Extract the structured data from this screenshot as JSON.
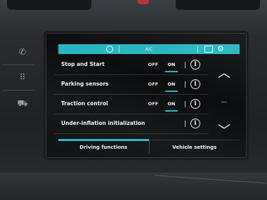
{
  "colors": {
    "accent": "#27b6bf",
    "screen_bg": "#0b0d0f",
    "text": "#f2f2f2"
  },
  "topbar": {
    "title": "A/C",
    "icons": [
      "fan-icon",
      "grid-icon",
      "gear-icon"
    ]
  },
  "rows": [
    {
      "label": "Stop and Start",
      "has_toggle": true,
      "off_label": "OFF",
      "on_label": "ON",
      "selected": "ON"
    },
    {
      "label": "Parking sensors",
      "has_toggle": true,
      "off_label": "OFF",
      "on_label": "ON",
      "selected": "ON"
    },
    {
      "label": "Traction control",
      "has_toggle": true,
      "off_label": "OFF",
      "on_label": "ON",
      "selected": "ON"
    },
    {
      "label": "Under-inflation initialization",
      "has_toggle": false
    }
  ],
  "info_glyph": "i",
  "scroll": {
    "up_glyph": "︿",
    "down_glyph": "﹀"
  },
  "bottom_tabs": [
    {
      "label": "Driving functions",
      "active": true
    },
    {
      "label": "Vehicle settings",
      "active": false
    }
  ]
}
